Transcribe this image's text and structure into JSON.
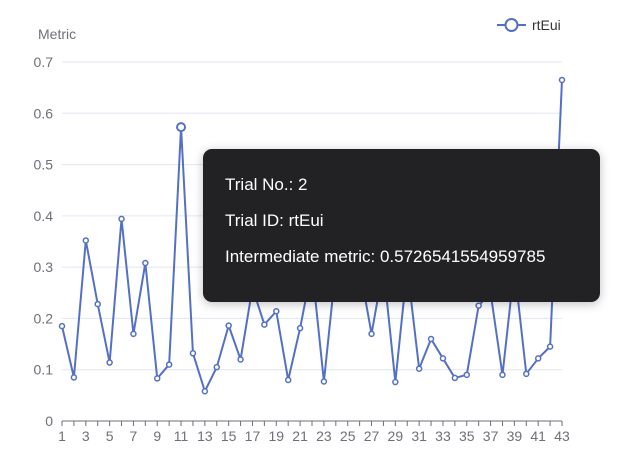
{
  "chart_data": {
    "type": "line",
    "ylabel": "Metric",
    "xlabel": "",
    "ylim": [
      0,
      0.7
    ],
    "yticks": [
      "0",
      "0.1",
      "0.2",
      "0.3",
      "0.4",
      "0.5",
      "0.6",
      "0.7"
    ],
    "xticks": [
      "1",
      "3",
      "5",
      "7",
      "9",
      "11",
      "13",
      "15",
      "17",
      "19",
      "21",
      "23",
      "25",
      "27",
      "29",
      "31",
      "33",
      "35",
      "37",
      "39",
      "41",
      "43"
    ],
    "x": [
      1,
      2,
      3,
      4,
      5,
      6,
      7,
      8,
      9,
      10,
      11,
      12,
      13,
      14,
      15,
      16,
      17,
      18,
      19,
      20,
      21,
      22,
      23,
      24,
      25,
      26,
      27,
      28,
      29,
      30,
      31,
      32,
      33,
      34,
      35,
      36,
      37,
      38,
      39,
      40,
      41,
      42,
      43
    ],
    "series": [
      {
        "name": "rtEui",
        "color": "#5470c6",
        "values": [
          0.185,
          0.085,
          0.352,
          0.228,
          0.114,
          0.394,
          0.17,
          0.308,
          0.083,
          0.11,
          0.573,
          0.132,
          0.058,
          0.105,
          0.186,
          0.12,
          0.26,
          0.188,
          0.214,
          0.08,
          0.181,
          0.3,
          0.077,
          0.3,
          0.33,
          0.3,
          0.17,
          0.3,
          0.076,
          0.3,
          0.102,
          0.16,
          0.122,
          0.084,
          0.09,
          0.225,
          0.25,
          0.09,
          0.3,
          0.092,
          0.122,
          0.145,
          0.665
        ]
      }
    ],
    "legend": "top-right",
    "grid": true
  },
  "legend": {
    "label": "rtEui"
  },
  "tooltip": {
    "line1": "Trial No.: 2",
    "line2": "Trial ID: rtEui",
    "line3": "Intermediate metric: 0.5726541554959785"
  }
}
